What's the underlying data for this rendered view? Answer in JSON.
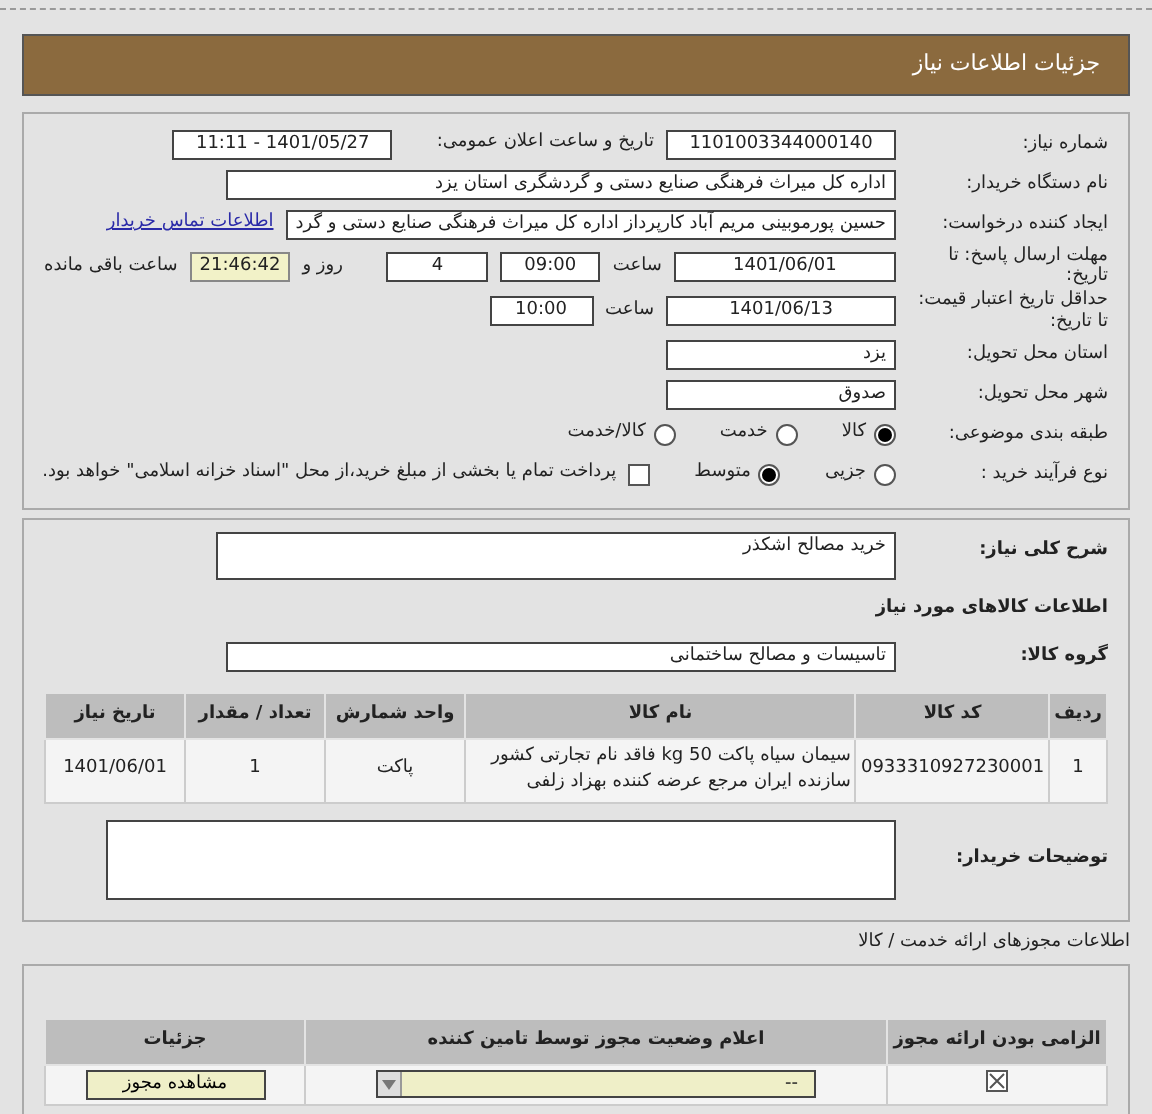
{
  "header": {
    "title": "جزئیات اطلاعات نیاز"
  },
  "need_info": {
    "need_number": {
      "label": "شماره نیاز:",
      "value": "1101003344000140"
    },
    "announce": {
      "label": "تاریخ و ساعت اعلان عمومی:",
      "value": "1401/05/27 - 11:11"
    },
    "buyer_org": {
      "label": "نام دستگاه خریدار:",
      "value": "اداره کل میراث فرهنگی  صنایع دستی و گردشگری استان یزد"
    },
    "requester": {
      "label": "ایجاد کننده درخواست:",
      "value": "حسین پورموبینی مریم آباد کارپرداز اداره کل میراث فرهنگی  صنایع دستی و گرد",
      "link": "اطلاعات تماس خریدار"
    },
    "deadline": {
      "label": "مهلت ارسال پاسخ: تا تاریخ:",
      "date": "1401/06/01",
      "time_label": "ساعت",
      "time": "09:00",
      "days": "4",
      "days_label": "روز و",
      "remaining": "21:46:42",
      "remaining_label": "ساعت باقی مانده"
    },
    "validity": {
      "label": "حداقل تاریخ اعتبار قیمت: تا تاریخ:",
      "date": "1401/06/13",
      "time_label": "ساعت",
      "time": "10:00"
    },
    "province": {
      "label": "استان محل تحویل:",
      "value": "یزد"
    },
    "city": {
      "label": "شهر محل تحویل:",
      "value": "صدوق"
    },
    "category": {
      "label": "طبقه بندی موضوعی:",
      "options": [
        {
          "label": "کالا",
          "selected": true
        },
        {
          "label": "خدمت",
          "selected": false
        },
        {
          "label": "کالا/خدمت",
          "selected": false
        }
      ]
    },
    "process": {
      "label": "نوع فرآیند خرید :",
      "options": [
        {
          "label": "جزیی",
          "selected": false
        },
        {
          "label": "متوسط",
          "selected": true
        }
      ],
      "treasury": {
        "label": "پرداخت تمام یا بخشی از مبلغ خرید،از محل \"اسناد خزانه اسلامی\" خواهد بود.",
        "checked": false
      }
    }
  },
  "goods": {
    "description": {
      "label": "شرح کلی نیاز:",
      "value": "خرید مصالح اشکذر"
    },
    "heading": "اطلاعات کالاهای مورد نیاز",
    "group": {
      "label": "گروه کالا:",
      "value": "تاسیسات و مصالح ساختمانی"
    },
    "table": {
      "columns": [
        "ردیف",
        "کد کالا",
        "نام کالا",
        "واحد شمارش",
        "تعداد / مقدار",
        "تاریخ نیاز"
      ],
      "rows": [
        [
          "1",
          "0933310927230001",
          "سیمان سیاه پاکت 50 kg فاقد نام تجارتی کشور سازنده ایران مرجع عرضه کننده بهزاد زلفی",
          "پاکت",
          "1",
          "1401/06/01"
        ]
      ]
    },
    "buyer_notes": {
      "label": "توضیحات خریدار:"
    }
  },
  "permits": {
    "title": "اطلاعات مجوزهای ارائه خدمت / کالا",
    "columns": [
      "الزامی بودن ارائه مجوز",
      "اعلام وضعیت مجوز توسط تامین کننده",
      "جزئیات"
    ],
    "rows": [
      {
        "required": true,
        "status": "--",
        "button": "مشاهده مجوز"
      }
    ]
  }
}
